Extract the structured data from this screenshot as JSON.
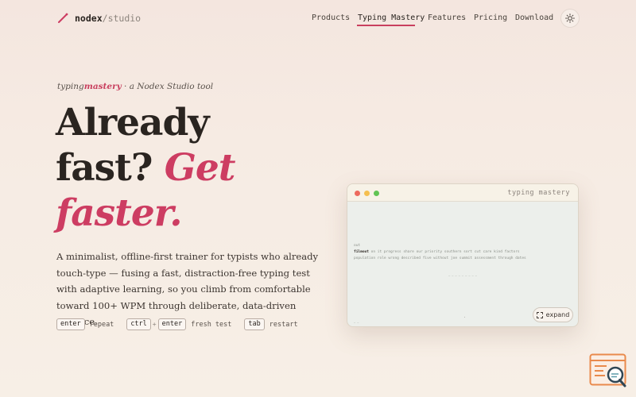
{
  "brand": {
    "name": "nodex",
    "separator": "/",
    "suffix": "studio"
  },
  "nav": {
    "items": [
      {
        "label": "Products",
        "active": false
      },
      {
        "label": "Typing Mastery",
        "active": true
      },
      {
        "label": "Features",
        "active": false
      },
      {
        "label": "Pricing",
        "active": false
      },
      {
        "label": "Download",
        "active": false
      }
    ],
    "theme_toggle_icon": "sun-icon"
  },
  "hero": {
    "tagline": {
      "product_plain": "typing",
      "product_accent": "mastery",
      "rest": " · a Nodex Studio tool"
    },
    "headline": {
      "line1": "Already",
      "line2_plain": "fast? ",
      "line2_accent": "Get",
      "line3_accent": "faster."
    },
    "description": "A minimalist, offline-first trainer for typists who already touch-type — fusing a fast, distraction-free typing test with adaptive learning, so you climb from comfortable toward 100+ WPM through deliberate, data-driven practice.",
    "shortcuts": [
      {
        "keys": [
          "enter"
        ],
        "description": "repeat"
      },
      {
        "keys": [
          "ctrl",
          "enter"
        ],
        "description": "fresh test"
      },
      {
        "keys": [
          "tab"
        ],
        "description": "restart"
      }
    ]
  },
  "preview": {
    "title": "typing mastery",
    "mode": "out",
    "typed_word": "filmout",
    "text_line1": " on it progress share our priority southern sort cut care kind factors",
    "text_line2": "population role wrong described five without joe summit assessment through dates",
    "hint": "—  —  —  —  —  —  —  —  —",
    "footer": "— —",
    "expand_label": "expand"
  },
  "colors": {
    "accent": "#cd3d62",
    "background": "#f6ebe3",
    "preview_bg": "#ecefeb",
    "widget": "#e98a4c"
  }
}
